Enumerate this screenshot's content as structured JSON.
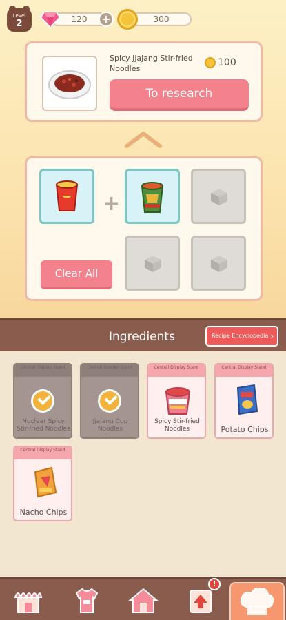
{
  "status": {
    "level_label": "Level",
    "level_value": "2",
    "gems": "120",
    "coins": "300"
  },
  "research": {
    "recipe_name": "Spicy Jjajang Stir-fried Noodles",
    "price": "100",
    "button_label": "To research"
  },
  "combine": {
    "clear_label": "Clear All"
  },
  "ingredients": {
    "title": "Ingredients",
    "encyclopedia_label": "Recipe Encyclopedia",
    "items": [
      {
        "tag": "Central Display Stand",
        "name": "Nuclear Spicy Stir-fried Noodles",
        "used": true
      },
      {
        "tag": "Central Display Stand",
        "name": "Jjajang Cup Noodles",
        "used": true
      },
      {
        "tag": "Central Display Stand",
        "name": "Spicy Stir-fried Noodles",
        "used": false
      },
      {
        "tag": "Central Display Stand",
        "name": "Potato Chips",
        "used": false
      },
      {
        "tag": "Central Display Stand",
        "name": "Nacho Chips",
        "used": false
      }
    ]
  },
  "nav": {
    "badge": "!"
  },
  "colors": {
    "accent": "#f4828c",
    "header_brown": "#8a5c4e",
    "slot_filled": "#d7f3f7"
  }
}
